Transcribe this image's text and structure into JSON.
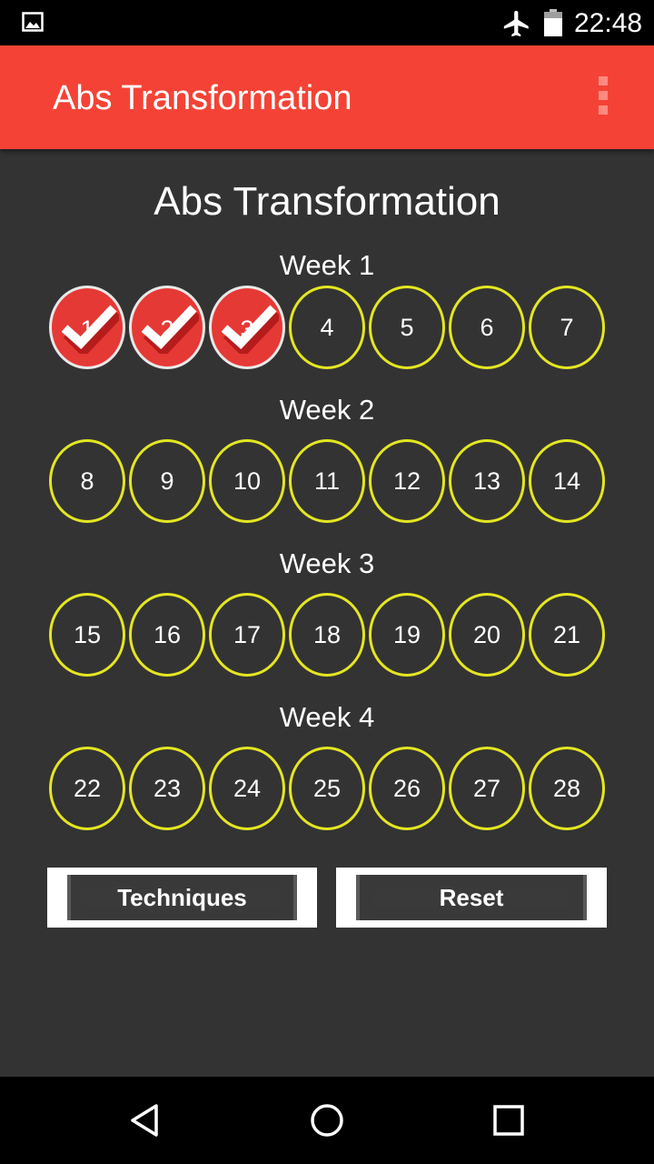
{
  "status_bar": {
    "time": "22:48",
    "icons": [
      "picture-icon",
      "airplane-mode-icon",
      "battery-icon"
    ]
  },
  "app_bar": {
    "title": "Abs Transformation",
    "menu_icon": "overflow-menu-icon"
  },
  "main": {
    "heading": "Abs Transformation",
    "weeks": [
      {
        "label": "Week 1",
        "days": [
          {
            "number": "1",
            "completed": true
          },
          {
            "number": "2",
            "completed": true
          },
          {
            "number": "3",
            "completed": true
          },
          {
            "number": "4",
            "completed": false
          },
          {
            "number": "5",
            "completed": false
          },
          {
            "number": "6",
            "completed": false
          },
          {
            "number": "7",
            "completed": false
          }
        ]
      },
      {
        "label": "Week 2",
        "days": [
          {
            "number": "8",
            "completed": false
          },
          {
            "number": "9",
            "completed": false
          },
          {
            "number": "10",
            "completed": false
          },
          {
            "number": "11",
            "completed": false
          },
          {
            "number": "12",
            "completed": false
          },
          {
            "number": "13",
            "completed": false
          },
          {
            "number": "14",
            "completed": false
          }
        ]
      },
      {
        "label": "Week 3",
        "days": [
          {
            "number": "15",
            "completed": false
          },
          {
            "number": "16",
            "completed": false
          },
          {
            "number": "17",
            "completed": false
          },
          {
            "number": "18",
            "completed": false
          },
          {
            "number": "19",
            "completed": false
          },
          {
            "number": "20",
            "completed": false
          },
          {
            "number": "21",
            "completed": false
          }
        ]
      },
      {
        "label": "Week 4",
        "days": [
          {
            "number": "22",
            "completed": false
          },
          {
            "number": "23",
            "completed": false
          },
          {
            "number": "24",
            "completed": false
          },
          {
            "number": "25",
            "completed": false
          },
          {
            "number": "26",
            "completed": false
          },
          {
            "number": "27",
            "completed": false
          },
          {
            "number": "28",
            "completed": false
          }
        ]
      }
    ],
    "buttons": {
      "techniques": "Techniques",
      "reset": "Reset"
    }
  },
  "nav_bar": {
    "icons": [
      "back-icon",
      "home-icon",
      "recents-icon"
    ]
  },
  "colors": {
    "app_bar": "#f44336",
    "background": "#333333",
    "day_ring": "#e4e622",
    "completed_fill": "#e53935"
  }
}
